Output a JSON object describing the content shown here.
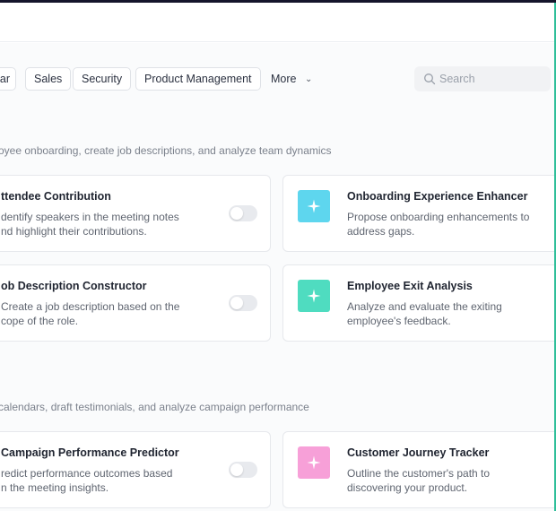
{
  "filters": {
    "chips": [
      "ar",
      "Sales",
      "Security",
      "Product Management"
    ],
    "more_label": "More",
    "search_placeholder": "Search"
  },
  "sections": [
    {
      "description": "oyee onboarding, create job descriptions, and analyze team dynamics",
      "cards": [
        {
          "title": "ttendee Contribution",
          "description": "dentify speakers in the meeting notes\nnd highlight their contributions.",
          "enabled": false
        },
        {
          "title": "Onboarding Experience Enhancer",
          "description": "Propose onboarding enhancements to\naddress gaps.",
          "icon": "sparkle-icon",
          "icon_color": "#5ed6ee"
        },
        {
          "title": "ob Description Constructor",
          "description": "Create a job description based on the\ncope of the role.",
          "enabled": false
        },
        {
          "title": "Employee Exit Analysis",
          "description": "Analyze and evaluate the exiting\nemployee's feedback.",
          "icon": "sparkle-icon",
          "icon_color": "#4fdcc0"
        }
      ]
    },
    {
      "description": "calendars, draft testimonials, and analyze campaign performance",
      "cards": [
        {
          "title": "Campaign Performance Predictor",
          "description": "redict performance outcomes based\nn the meeting insights.",
          "enabled": false
        },
        {
          "title": "Customer Journey Tracker",
          "description": "Outline the customer's path to\ndiscovering your product.",
          "icon": "sparkle-icon",
          "icon_color": "#f7a0d8"
        }
      ]
    }
  ],
  "colors": {
    "top_bar": "#14142b",
    "right_edge_accent": "#2fbf9a"
  }
}
